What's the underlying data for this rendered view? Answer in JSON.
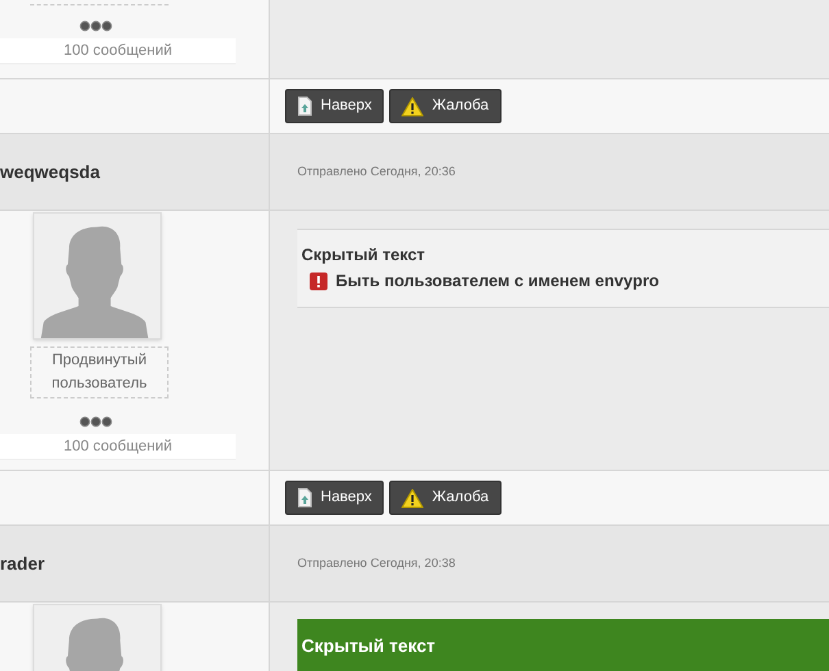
{
  "posts": [
    {
      "posts_count": "100 сообщений",
      "buttons": [
        {
          "kind": "top",
          "label": "Наверх"
        },
        {
          "kind": "report",
          "label": "Жалоба"
        }
      ]
    },
    {
      "author": "weqweqsda",
      "sent": "Отправлено Сегодня, 20:36",
      "rank": "Продвинутый пользователь",
      "posts_count": "100 сообщений",
      "hidden": {
        "kind": "locked",
        "title": "Скрытый текст",
        "requirement": "Быть пользователем с именем envypro"
      },
      "buttons": [
        {
          "kind": "top",
          "label": "Наверх"
        },
        {
          "kind": "report",
          "label": "Жалоба"
        }
      ]
    },
    {
      "author": "rader",
      "sent": "Отправлено Сегодня, 20:38",
      "hidden": {
        "kind": "revealed",
        "title": "Скрытый текст"
      }
    }
  ]
}
